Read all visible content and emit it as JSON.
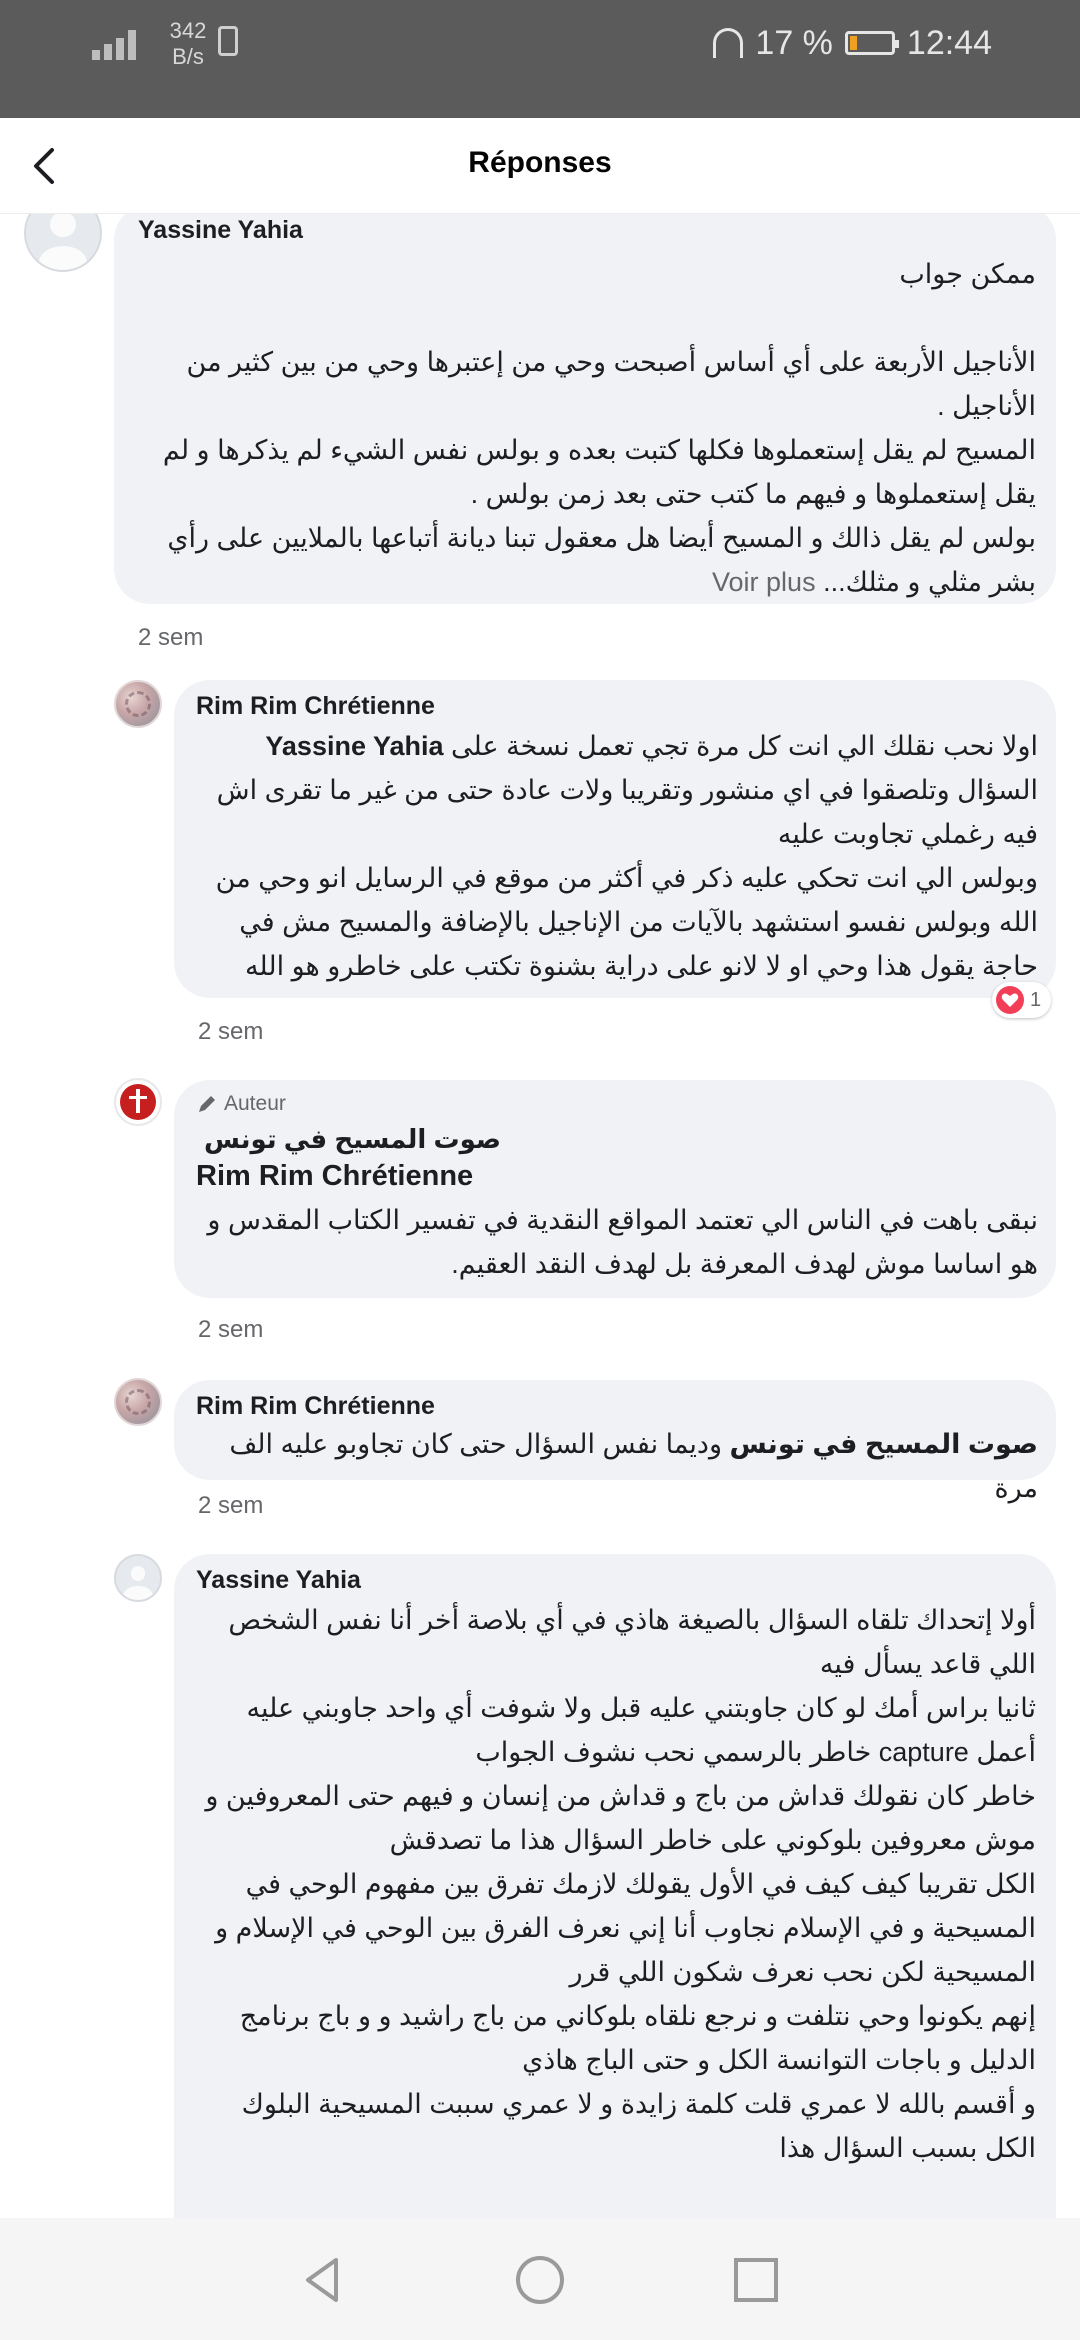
{
  "status_bar": {
    "network_speed_value": "342",
    "network_speed_unit": "B/s",
    "battery_percent": "17 %",
    "battery_level": 0.17,
    "time": "12:44",
    "colors": {
      "background": "#5b5b5b",
      "battery_fill": "#f0a020"
    }
  },
  "header": {
    "title": "Réponses"
  },
  "comments": [
    {
      "author": "Yassine Yahia",
      "paragraphs": [
        "ممكن جواب",
        "الأناجيل الأربعة على أي أساس أصبحت وحي من إعتبرها وحي من بين كثير من الأناجيل .",
        "المسيح لم يقل إستعملوها فكلها كتبت بعده و بولس نفس الشيء لم يذكرها و لم يقل إستعملوها و فيهم ما كتب حتى بعد زمن بولس .",
        "بولس لم يقل ذالك و المسيح أيضا هل معقول تبنا ديانة أتباعها بالملايين على رأي بشر مثلي و مثلك..."
      ],
      "see_more": "Voir plus",
      "time": "2 sem"
    },
    {
      "author": "Rim Rim Chrétienne",
      "mention": "Yassine Yahia",
      "lead": "اولا نحب نقلك الي انت كل مرة تجي تعمل نسخة على",
      "paragraphs": [
        "السؤال وتلصقوا في اي منشور وتقريبا ولات عادة حتى من غير ما تقرى اش فيه رغملي تجاوبت عليه",
        "وبولس الي انت تحكي عليه ذكر في أكثر من موقع في الرسايل انو وحي من الله وبولس نفسو استشهد بالآيات من الإناجيل بالإضافة والمسيح مش في حاجة يقول هذا وحي او لا لانو على دراية بشنوة تكتب على خاطرو هو الله"
      ],
      "reaction_count": "1",
      "time": "2 sem"
    },
    {
      "badge": "Auteur",
      "author": "صوت المسيح في تونس",
      "mention": "Rim Rim Chrétienne",
      "paragraphs": [
        "نبقى باهت في الناس الي تعتمد المواقع النقدية في تفسير الكتاب المقدس و هو اساسا موش لهدف المعرفة بل لهدف النقد العقيم."
      ],
      "time": "2 sem"
    },
    {
      "author": "Rim Rim Chrétienne",
      "mention": "صوت المسيح في تونس",
      "text": "وديما نفس السؤال حتى كان تجاوبو عليه الف مرة",
      "time": "2 sem"
    },
    {
      "author": "Yassine Yahia",
      "paragraphs": [
        "أولا إتحداك تلقاه السؤال بالصيغة هاذي في أي بلاصة أخر أنا نفس الشخص اللي قاعد يسأل فيه",
        "ثانيا براس أمك لو كان جاوبتني عليه قبل ولا شوفت أي واحد جاوبني عليه أعمل capture خاطر بالرسمي نحب نشوف الجواب",
        "خاطر كان نقولك قداش من باج و قداش من إنسان و فيهم حتى المعروفين و موش معروفين بلوكوني على خاطر السؤال هذا ما تصدقش",
        "الكل تقريبا كيف كيف في الأول يقولك لازمك تفرق بين مفهوم الوحي في المسيحية و في الإسلام نجاوب أنا إني نعرف الفرق بين الوحي في الإسلام و المسيحية لكن نحب نعرف شكون اللي قرر",
        "إنهم يكونوا وحي نتلفت و نرجع نلقاه بلوكاني من باج راشيد و و باج برنامج الدليل و باجات التوانسة الكل و حتى الباج هاذي",
        "و أقسم بالله لا عمري قلت كلمة زايدة و لا عمري سببت المسيحية البلوك الكل بسبب السؤال هذا"
      ]
    }
  ],
  "nav": {
    "back_icon": "triangle-back-icon",
    "home_icon": "circle-home-icon",
    "recents_icon": "square-recents-icon"
  }
}
